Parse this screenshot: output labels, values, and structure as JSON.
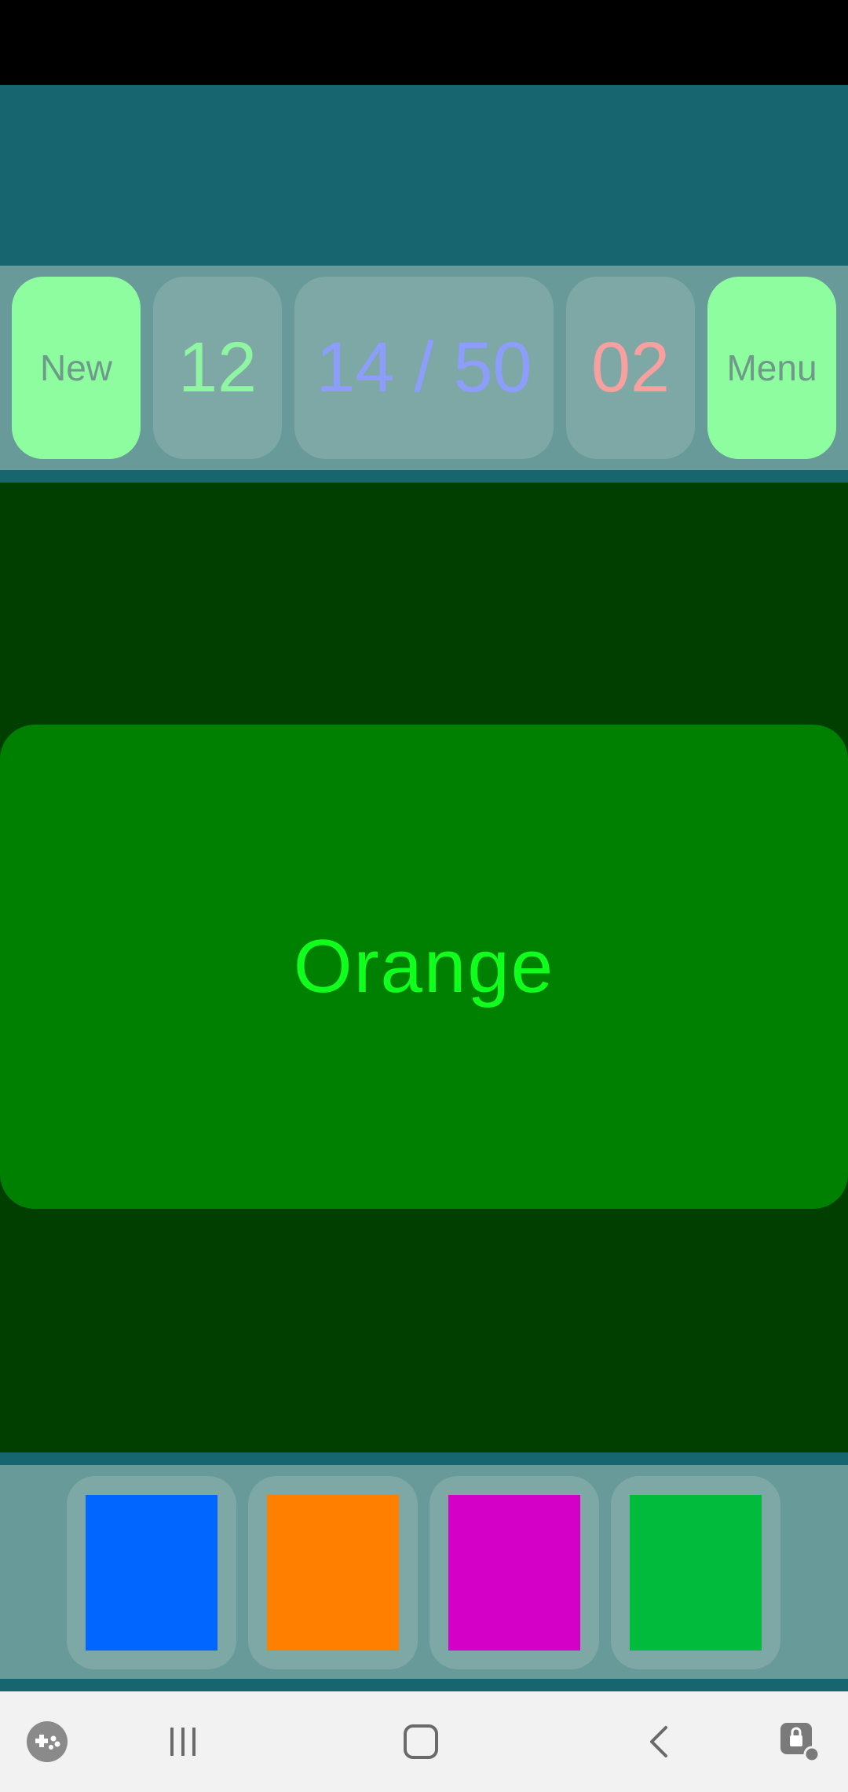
{
  "toolbar": {
    "new_label": "New",
    "score": "12",
    "progress": "14 / 50",
    "errors": "02",
    "menu_label": "Menu"
  },
  "colors": {
    "action_bg": "#8dfda0",
    "score_text": "#90f5a2",
    "progress_text": "#8c9dfc",
    "errors_text": "#f8a0a0",
    "card_bg": "#008000",
    "word_text": "#11ff1c"
  },
  "prompt": {
    "word": "Orange"
  },
  "palette": {
    "swatches": [
      {
        "name": "blue",
        "color": "#0066ff"
      },
      {
        "name": "orange",
        "color": "#ff7f00"
      },
      {
        "name": "magenta",
        "color": "#d400c8"
      },
      {
        "name": "green",
        "color": "#00bb3c"
      }
    ]
  },
  "nav": {
    "icons": [
      "game-launcher-icon",
      "recent-apps-icon",
      "home-icon",
      "back-icon",
      "screen-lock-icon"
    ]
  }
}
